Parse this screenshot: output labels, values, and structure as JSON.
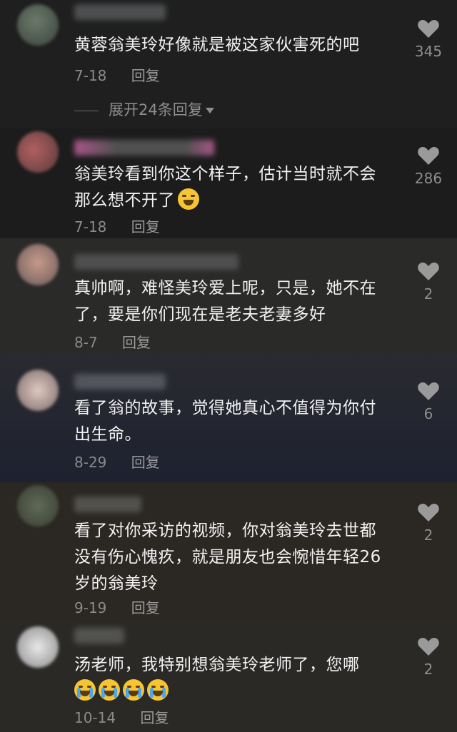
{
  "colors": {
    "comment_bg": [
      "#1f1f1f",
      "#1c1c1d",
      "#2a2a29",
      "#2a2a30",
      "#1d2230",
      "#2b2722",
      "#2a2926"
    ],
    "like_icon": "#9a9a9a"
  },
  "comments": [
    {
      "text": "黄蓉翁美玲好像就是被这家伙害死的吧",
      "date": "7-18",
      "reply_label": "回复",
      "likes": "345",
      "expand_label": "展开24条回复",
      "emoji": []
    },
    {
      "text": "翁美玲看到你这个样子，估计当时就不会那么想不开了",
      "date": "7-18",
      "reply_label": "回复",
      "likes": "286",
      "emoji": [
        "grin-tears-emoji"
      ]
    },
    {
      "text": "真帅啊，难怪美玲爱上呢，只是，她不在了，要是你们现在是老夫老妻多好",
      "date": "8-7",
      "reply_label": "回复",
      "likes": "2",
      "emoji": []
    },
    {
      "text": "看了翁的故事，觉得她真心不值得为你付出生命。",
      "date": "8-29",
      "reply_label": "回复",
      "likes": "6",
      "emoji": []
    },
    {
      "text": "看了对你采访的视频，你对翁美玲去世都没有伤心愧疚，就是朋友也会惋惜年轻26岁的翁美玲",
      "date": "9-19",
      "reply_label": "回复",
      "likes": "2",
      "emoji": []
    },
    {
      "text": "汤老师，我特别想翁美玲老师了，您哪",
      "date": "10-14",
      "reply_label": "回复",
      "likes": "2",
      "emoji": [
        "crying-emoji",
        "crying-emoji",
        "crying-emoji",
        "crying-emoji"
      ]
    }
  ]
}
